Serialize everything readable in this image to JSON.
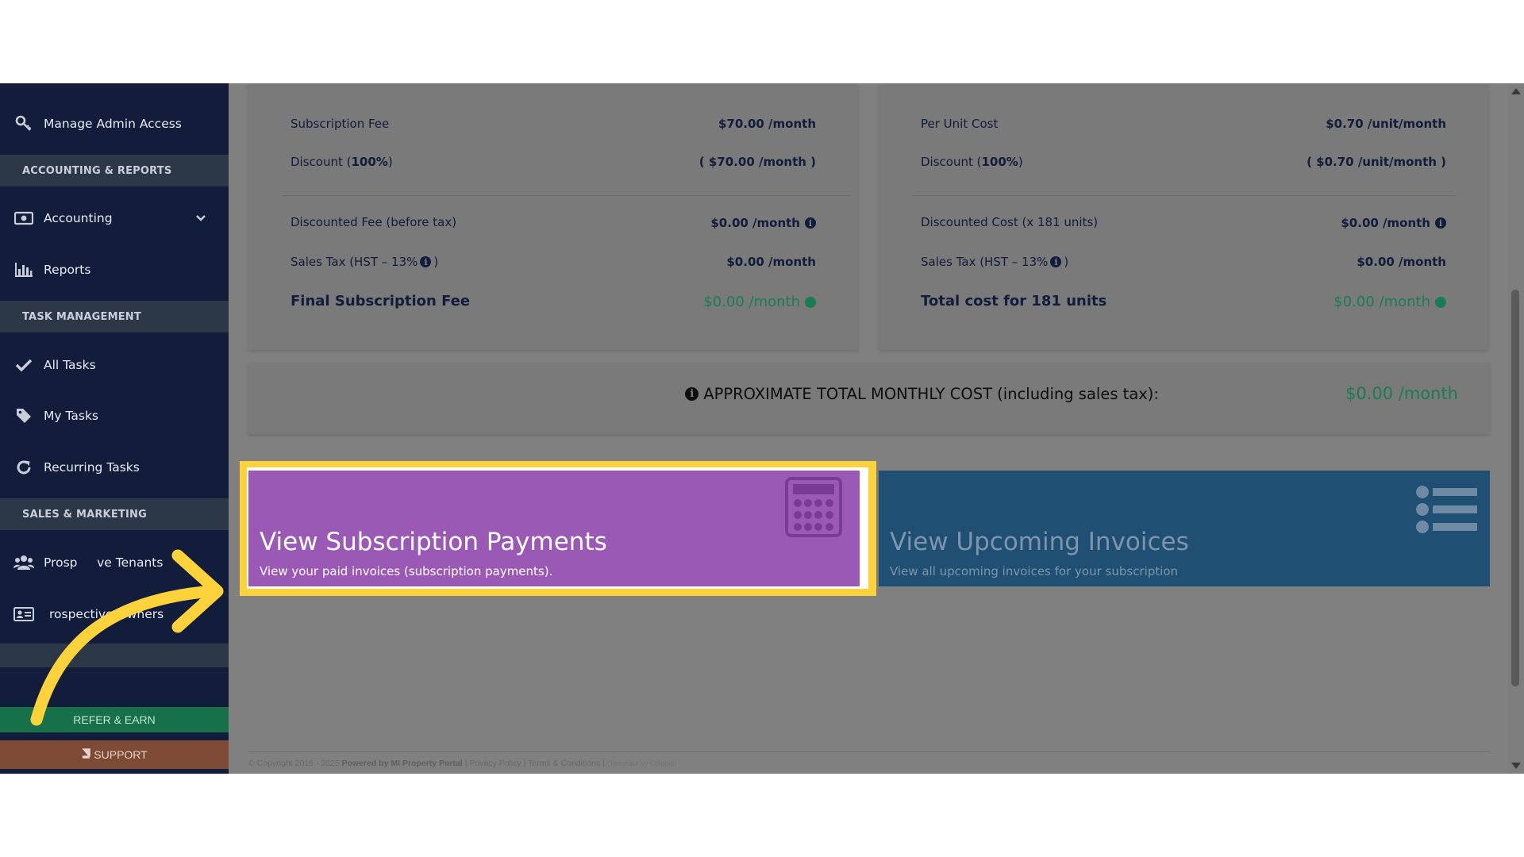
{
  "colors": {
    "sidebar_bg": "#121c3b",
    "section_header_bg": "#2c3747",
    "accent_green": "#1a7c56",
    "tile_purple": "#9b59b6",
    "tile_blue": "#1f4f73",
    "highlight_yellow": "#fdd23a",
    "overlay_gray": "#808080"
  },
  "sidebar": {
    "items": [
      {
        "label": "Manage Admin Access",
        "icon": "key-icon"
      },
      {
        "label": "Accounting",
        "icon": "money-icon"
      },
      {
        "label": "Reports",
        "icon": "bar-chart-icon"
      },
      {
        "label": "All Tasks",
        "icon": "check-icon"
      },
      {
        "label": "My Tasks",
        "icon": "tag-icon"
      },
      {
        "label": "Recurring Tasks",
        "icon": "refresh-icon"
      },
      {
        "label": "Prosp     ve Tenants",
        "icon": "users-icon"
      },
      {
        "label": "rospective Owners",
        "icon": "id-card-icon"
      }
    ],
    "sections": {
      "accounting": "ACCOUNTING & REPORTS",
      "tasks": "TASK MANAGEMENT",
      "sales": "SALES & MARKETING"
    },
    "refer_label": "REFER & EARN",
    "support_label": "SUPPORT"
  },
  "subscription": {
    "fee_label": "Subscription Fee",
    "fee_value": "$70.00 /month",
    "discount_label": "Discount (",
    "discount_pct": "100%",
    "discount_close": ")",
    "discount_value": "( $70.00 /month )",
    "discounted_label": "Discounted Fee (before tax)",
    "discounted_value": "$0.00 /month",
    "tax_label": "Sales Tax (HST – 13%",
    "tax_value": "$0.00 /month",
    "final_label": "Final Subscription Fee",
    "final_value": "$0.00 /month"
  },
  "per_unit": {
    "cost_label": "Per Unit Cost",
    "cost_value": "$0.70 /unit/month",
    "discount_label": "Discount (",
    "discount_pct": "100%",
    "discount_close": ")",
    "discount_value": "( $0.70 /unit/month )",
    "discounted_label": "Discounted Cost (x 181 units)",
    "discounted_value": "$0.00 /month",
    "tax_label": "Sales Tax (HST – 13%",
    "tax_value": "$0.00 /month",
    "total_label": "Total cost for 181 units",
    "total_value": "$0.00 /month"
  },
  "total": {
    "label": "APPROXIMATE TOTAL MONTHLY COST (including sales tax):",
    "value": "$0.00 /month"
  },
  "tiles": {
    "payments_title": "View Subscription Payments",
    "payments_sub": "View your paid invoices (subscription payments).",
    "payments_icon": "calculator-icon",
    "invoices_title": "View Upcoming Invoices",
    "invoices_sub": "View all upcoming invoices for your subscription",
    "invoices_icon": "list-icon"
  },
  "footer": {
    "copyright": "© Copyright 2016 - 2025",
    "powered": "Powered by MI Property Portal",
    "privacy": "Privacy Policy",
    "terms": "Terms & Conditions",
    "template": "(Template by Colorlib)",
    "sep": "|"
  },
  "info_glyph": "i"
}
